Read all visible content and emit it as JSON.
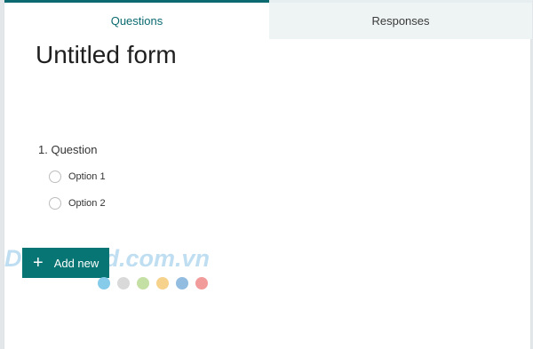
{
  "tabs": {
    "questions": "Questions",
    "responses": "Responses"
  },
  "form": {
    "title": "Untitled form",
    "question": "1. Question",
    "options": [
      "Option 1",
      "Option 2"
    ]
  },
  "add_new": {
    "label": "Add new",
    "icon": "plus-icon"
  },
  "watermark": {
    "text": "Download.com.vn",
    "visible_fragment": "ad.com.vn"
  },
  "watermark_dots": [
    "#86cbe9",
    "#d9d9d9",
    "#c5e0a5",
    "#f6d28d",
    "#92bde0",
    "#f29b9b"
  ],
  "colors": {
    "accent": "#077573",
    "tab_active": "#0b6a6f"
  }
}
